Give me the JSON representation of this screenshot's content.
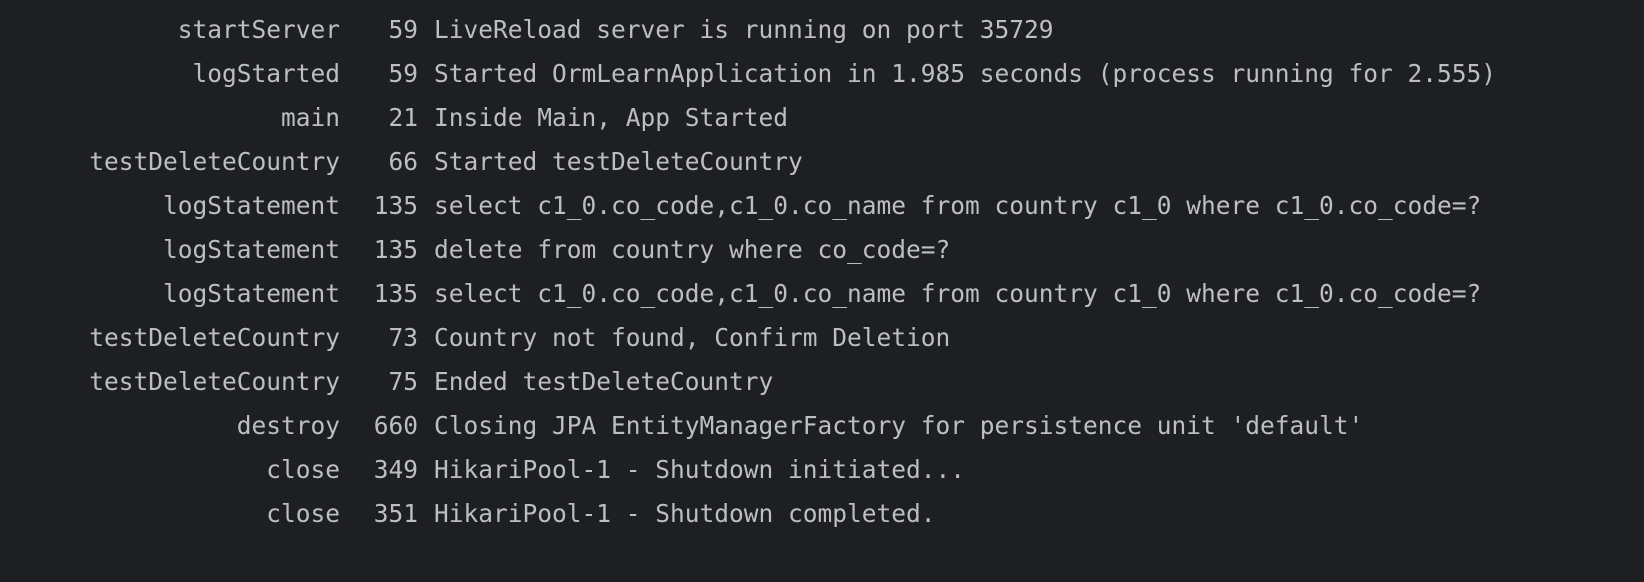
{
  "console": {
    "background": "#1e1f22",
    "text_color": "#bcbec4",
    "lines": [
      {
        "method": "startServer",
        "line": "59",
        "message": "LiveReload server is running on port 35729"
      },
      {
        "method": "logStarted",
        "line": "59",
        "message": "Started OrmLearnApplication in 1.985 seconds (process running for 2.555)"
      },
      {
        "method": "main",
        "line": "21",
        "message": "Inside Main, App Started"
      },
      {
        "method": "testDeleteCountry",
        "line": "66",
        "message": "Started testDeleteCountry"
      },
      {
        "method": "logStatement",
        "line": "135",
        "message": "select c1_0.co_code,c1_0.co_name from country c1_0 where c1_0.co_code=?"
      },
      {
        "method": "logStatement",
        "line": "135",
        "message": "delete from country where co_code=?"
      },
      {
        "method": "logStatement",
        "line": "135",
        "message": "select c1_0.co_code,c1_0.co_name from country c1_0 where c1_0.co_code=?"
      },
      {
        "method": "testDeleteCountry",
        "line": "73",
        "message": "Country not found, Confirm Deletion"
      },
      {
        "method": "testDeleteCountry",
        "line": "75",
        "message": "Ended testDeleteCountry"
      },
      {
        "method": "destroy",
        "line": "660",
        "message": "Closing JPA EntityManagerFactory for persistence unit 'default'"
      },
      {
        "method": "close",
        "line": "349",
        "message": "HikariPool-1 - Shutdown initiated..."
      },
      {
        "method": "close",
        "line": "351",
        "message": "HikariPool-1 - Shutdown completed."
      }
    ]
  }
}
